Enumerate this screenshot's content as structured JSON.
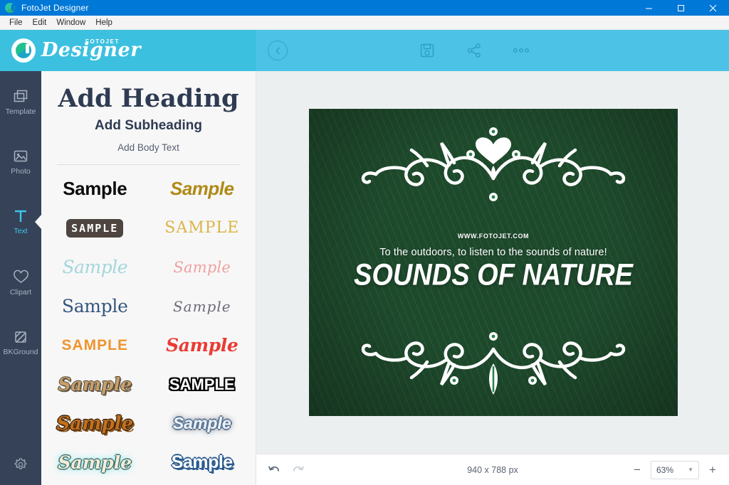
{
  "window": {
    "title": "FotoJet Designer",
    "app_icon": "fotojet-icon",
    "controls": [
      {
        "name": "minimize-button",
        "glyph": "minimize-icon"
      },
      {
        "name": "maximize-button",
        "glyph": "maximize-icon"
      },
      {
        "name": "close-button",
        "glyph": "close-icon"
      }
    ]
  },
  "menubar": {
    "items": [
      {
        "label": "File"
      },
      {
        "label": "Edit"
      },
      {
        "label": "Window"
      },
      {
        "label": "Help"
      }
    ]
  },
  "logo": {
    "small_text": "FOTOJET",
    "big_text": "Designer",
    "background": "#3cc0e0"
  },
  "toolbar": {
    "background": "#4cc3e6",
    "back_label": "back-icon",
    "actions": [
      {
        "name": "save-button",
        "icon": "save-floppy-icon"
      },
      {
        "name": "share-button",
        "icon": "share-nodes-icon"
      },
      {
        "name": "more-button",
        "icon": "more-dots-icon"
      }
    ]
  },
  "sidebar": {
    "background": "#354258",
    "active_color": "#3ec8ef",
    "items": [
      {
        "label": "Template",
        "icon": "template-icon",
        "active": false
      },
      {
        "label": "Photo",
        "icon": "photo-icon",
        "active": false
      },
      {
        "label": "Text",
        "icon": "text-t-icon",
        "active": true
      },
      {
        "label": "Clipart",
        "icon": "heart-icon",
        "active": false
      },
      {
        "label": "BKGround",
        "icon": "background-icon",
        "active": false
      }
    ],
    "settings": {
      "label": "Settings",
      "icon": "gear-icon"
    }
  },
  "text_panel": {
    "add_heading": "Add Heading",
    "add_subheading": "Add Subheading",
    "add_body_text": "Add Body Text",
    "styles": [
      {
        "label": "Sample",
        "style": "st1",
        "name": "text-style-bold-black"
      },
      {
        "label": "Sample",
        "style": "st2",
        "name": "text-style-bold-italic-gold"
      },
      {
        "label": "SAMPLE",
        "style": "st3",
        "name": "text-style-mono-badge-brown"
      },
      {
        "label": "SAMPLE",
        "style": "st4",
        "name": "text-style-serif-caps-gold"
      },
      {
        "label": "Sample",
        "style": "st5",
        "name": "text-style-script-lightblue"
      },
      {
        "label": "Sample",
        "style": "st6",
        "name": "text-style-script-pink"
      },
      {
        "label": "Sample",
        "style": "st7",
        "name": "text-style-serif-navy"
      },
      {
        "label": "Sample",
        "style": "st8",
        "name": "text-style-thin-script-gray"
      },
      {
        "label": "SAMPLE",
        "style": "st9",
        "name": "text-style-brush-caps-orange"
      },
      {
        "label": "Sample",
        "style": "st10",
        "name": "text-style-brush-red"
      },
      {
        "label": "Sample",
        "style": "st11",
        "name": "text-style-outline-tan"
      },
      {
        "label": "SAMPLE",
        "style": "st12",
        "name": "text-style-white-black-outline"
      },
      {
        "label": "Sample",
        "style": "st13",
        "name": "text-style-retro-orange-shadow"
      },
      {
        "label": "Sample",
        "style": "st14",
        "name": "text-style-glow-steel-blue"
      },
      {
        "label": "Sample",
        "style": "st15",
        "name": "text-style-cream-teal-glow"
      },
      {
        "label": "Sample",
        "style": "st16",
        "name": "text-style-white-blue-outline"
      }
    ]
  },
  "canvas": {
    "url_text": "WWW.FOTOJET.COM",
    "tagline": "To the outdoors, to listen to the sounds of nature!",
    "title": "SOUNDS OF NATURE",
    "ornament_top": "floral-flourish-heart-icon",
    "ornament_bottom": "floral-flourish-icon"
  },
  "bottombar": {
    "undo": "undo-icon",
    "redo": "redo-icon",
    "size_text": "940 x 788 px",
    "zoom_value": "63%",
    "zoom_out": "−",
    "zoom_in": "+"
  }
}
